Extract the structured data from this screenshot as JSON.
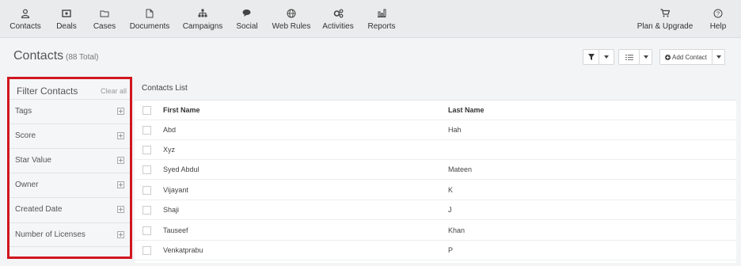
{
  "nav": {
    "items": [
      {
        "label": "Contacts",
        "icon": "user-icon"
      },
      {
        "label": "Deals",
        "icon": "money-icon"
      },
      {
        "label": "Cases",
        "icon": "folder-icon"
      },
      {
        "label": "Documents",
        "icon": "document-icon"
      },
      {
        "label": "Campaigns",
        "icon": "sitemap-icon"
      },
      {
        "label": "Social",
        "icon": "comments-icon"
      },
      {
        "label": "Web Rules",
        "icon": "globe-icon"
      },
      {
        "label": "Activities",
        "icon": "gears-icon"
      },
      {
        "label": "Reports",
        "icon": "bar-chart-icon"
      }
    ],
    "right_items": [
      {
        "label": "Plan & Upgrade",
        "icon": "cart-icon"
      },
      {
        "label": "Help",
        "icon": "help-icon"
      }
    ]
  },
  "header": {
    "title": "Contacts",
    "count": "(88 Total)",
    "add_contact": "Add Contact"
  },
  "filters": {
    "title": "Filter Contacts",
    "clear_all": "Clear all",
    "items": [
      "Tags",
      "Score",
      "Star Value",
      "Owner",
      "Created Date",
      "Number of Licenses"
    ]
  },
  "list": {
    "title": "Contacts List",
    "columns": [
      "First Name",
      "Last Name"
    ],
    "rows": [
      {
        "first": "Abd",
        "last": "Hah"
      },
      {
        "first": "Xyz",
        "last": ""
      },
      {
        "first": "Syed Abdul",
        "last": "Mateen"
      },
      {
        "first": "Vijayant",
        "last": "K"
      },
      {
        "first": "Shaji",
        "last": "J"
      },
      {
        "first": "Tauseef",
        "last": "Khan"
      },
      {
        "first": "Venkatprabu",
        "last": "P"
      }
    ]
  },
  "colors": {
    "highlight": "#d0161f",
    "nav_bg": "#eaebec"
  }
}
